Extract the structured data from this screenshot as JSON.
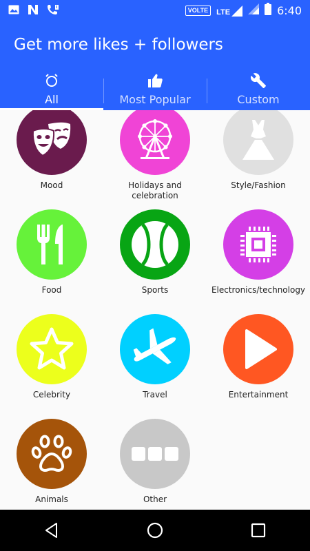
{
  "status_bar": {
    "time": "6:40",
    "network_badge": "VOLTE",
    "network_type": "LTE",
    "icons": [
      "image-icon",
      "n-icon",
      "phone-icon",
      "volte-badge",
      "lte-signal-icon",
      "signal-icon",
      "battery-icon"
    ]
  },
  "app": {
    "title": "Get more likes + followers",
    "primary_color": "#2962ff"
  },
  "tabs": [
    {
      "label": "All",
      "icon": "clock-icon",
      "active": true
    },
    {
      "label": "Most Popular",
      "icon": "thumbs-up-icon",
      "active": false
    },
    {
      "label": "Custom",
      "icon": "wrench-icon",
      "active": false
    }
  ],
  "categories": [
    {
      "label": "Mood",
      "icon": "theater-masks-icon",
      "color": "#6a1b4d"
    },
    {
      "label": "Holidays and celebration",
      "icon": "ferris-wheel-icon",
      "color": "#f044d6"
    },
    {
      "label": "Style/Fashion",
      "icon": "dress-icon",
      "color": "#e0e0e0"
    },
    {
      "label": "Food",
      "icon": "fork-knife-icon",
      "color": "#66f23a"
    },
    {
      "label": "Sports",
      "icon": "tennis-ball-icon",
      "color": "#08a514"
    },
    {
      "label": "Electronics/technology",
      "icon": "chip-icon",
      "color": "#d43fe6"
    },
    {
      "label": "Celebrity",
      "icon": "star-icon",
      "color": "#ecff1c"
    },
    {
      "label": "Travel",
      "icon": "airplane-icon",
      "color": "#00d0ff"
    },
    {
      "label": "Entertainment",
      "icon": "play-icon",
      "color": "#ff5722"
    },
    {
      "label": "Animals",
      "icon": "paw-icon",
      "color": "#a5540a"
    },
    {
      "label": "Other",
      "icon": "more-icon",
      "color": "#c8c8c8"
    }
  ],
  "nav": {
    "buttons": [
      "back-icon",
      "home-icon",
      "recents-icon"
    ]
  }
}
